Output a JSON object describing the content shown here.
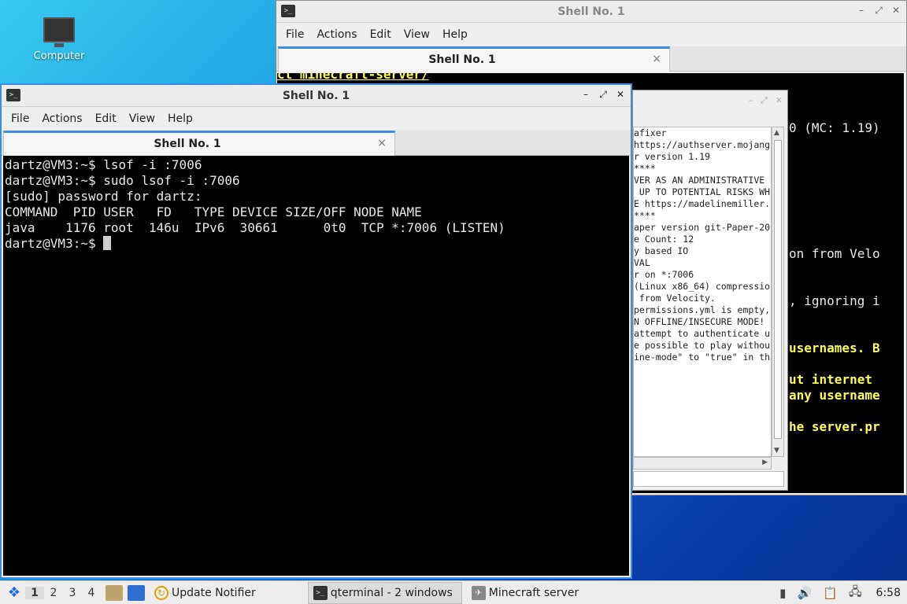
{
  "desktop": {
    "icons": [
      {
        "label": "Computer"
      }
    ]
  },
  "back_window": {
    "title": "Shell No. 1",
    "menu": [
      "File",
      "Actions",
      "Edit",
      "View",
      "Help"
    ],
    "tab_label": "Shell No. 1",
    "tab_close": "×",
    "top_text": "ct minecraft-server/",
    "right_fragments": [
      {
        "text": "0 (MC: 1.19)",
        "color": "normal"
      },
      {
        "text": "on from Velo",
        "color": "normal"
      },
      {
        "text": ", ignoring i",
        "color": "normal"
      },
      {
        "text": "usernames. B",
        "color": "yellow"
      },
      {
        "text": "ut internet",
        "color": "yellow"
      },
      {
        "text": "any username",
        "color": "yellow"
      },
      {
        "text": "he server.pr",
        "color": "yellow"
      }
    ]
  },
  "third_window": {
    "log_lines": [
      "afixer",
      "https://authserver.mojang.",
      "",
      "r version 1.19",
      "****",
      "VER AS AN ADMINISTRATIVE",
      " UP TO POTENTIAL RISKS WH",
      "E https://madelinemiller.",
      "****",
      "",
      "aper version git-Paper-20",
      "e Count: 12",
      "y based IO",
      "VAL",
      "",
      "r on *:7006",
      "",
      "(Linux x86_64) compressio",
      " from Velocity.",
      "permissions.yml is empty,",
      "N OFFLINE/INSECURE MODE!",
      "attempt to authenticate u",
      "e possible to play withou",
      "ine-mode\" to \"true\" in th"
    ]
  },
  "front_window": {
    "title": "Shell No. 1",
    "menu": [
      "File",
      "Actions",
      "Edit",
      "View",
      "Help"
    ],
    "tab_label": "Shell No. 1",
    "tab_close": "×",
    "terminal_lines": [
      "dartz@VM3:~$ lsof -i :7006",
      "dartz@VM3:~$ sudo lsof -i :7006",
      "[sudo] password for dartz:",
      "COMMAND  PID USER   FD   TYPE DEVICE SIZE/OFF NODE NAME",
      "java    1176 root  146u  IPv6  30661      0t0  TCP *:7006 (LISTEN)"
    ],
    "prompt": "dartz@VM3:~$ "
  },
  "taskbar": {
    "workspaces": [
      "1",
      "2",
      "3",
      "4"
    ],
    "active_workspace": "1",
    "tasks": [
      {
        "label": "Update Notifier",
        "icon": "update-notifier-icon"
      },
      {
        "label": "qterminal - 2 windows",
        "icon": "terminal-icon"
      },
      {
        "label": "Minecraft server",
        "icon": "minecraft-server-icon"
      }
    ],
    "clock": "6:58"
  },
  "colors": {
    "accent": "#3a8ee6",
    "terminal_bg": "#000000",
    "terminal_fg": "#e8e8e8",
    "terminal_yellow": "#ffff55"
  }
}
